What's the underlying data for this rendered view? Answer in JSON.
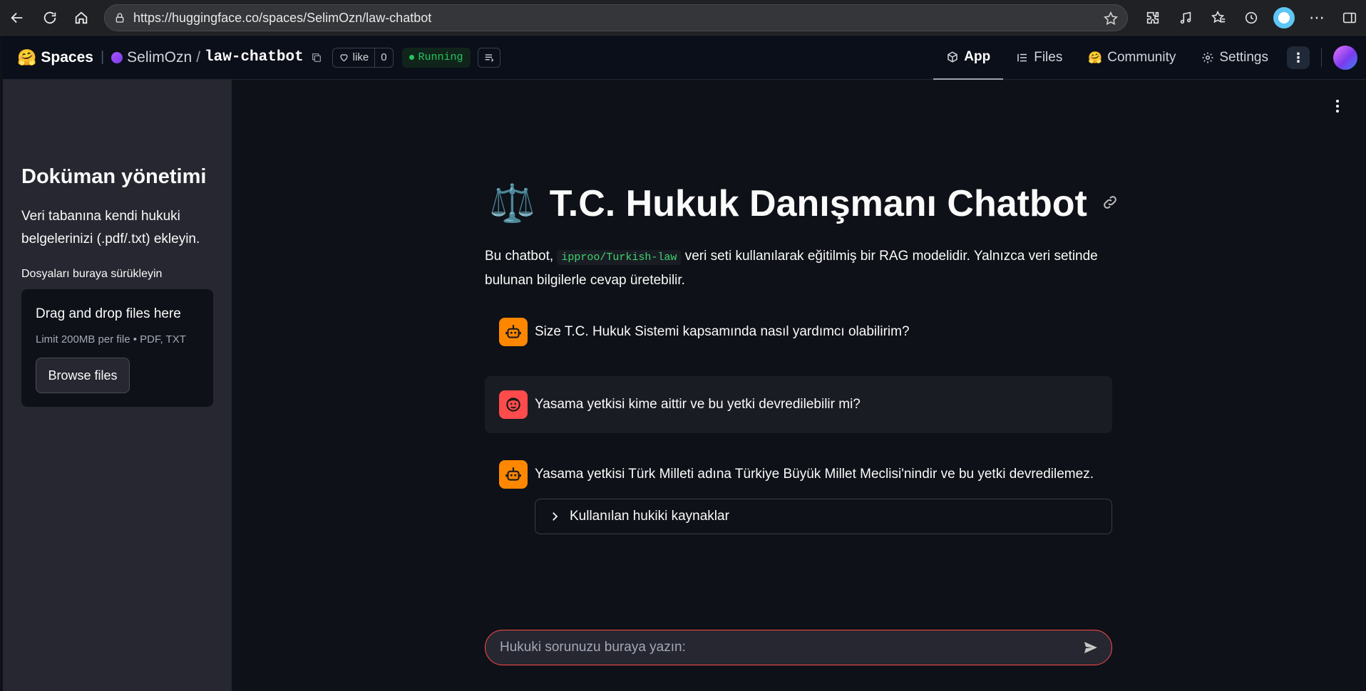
{
  "browser": {
    "url": "https://huggingface.co/spaces/SelimOzn/law-chatbot"
  },
  "header": {
    "logo_label": "Spaces",
    "logo_emoji": "🤗",
    "owner": "SelimOzn",
    "repo": "law-chatbot",
    "like_label": "like",
    "like_count": "0",
    "status": "Running",
    "tabs": [
      {
        "label": "App",
        "icon": "cube-icon",
        "active": true
      },
      {
        "label": "Files",
        "icon": "files-icon",
        "active": false
      },
      {
        "label": "Community",
        "icon": "community-icon",
        "active": false
      },
      {
        "label": "Settings",
        "icon": "gear-icon",
        "active": false
      }
    ]
  },
  "sidebar": {
    "title": "Doküman yönetimi",
    "description": "Veri tabanına kendi hukuki belgelerinizi (.pdf/.txt) ekleyin.",
    "upload_label": "Dosyaları buraya sürükleyin",
    "dropzone_title": "Drag and drop files here",
    "dropzone_limit": "Limit 200MB per file • PDF, TXT",
    "browse_label": "Browse files"
  },
  "main": {
    "title_emoji": "⚖️",
    "title": "T.C. Hukuk Danışmanı Chatbot",
    "intro_before": "Bu chatbot, ",
    "intro_code": "ipproo/Turkish-law",
    "intro_after": " veri seti kullanılarak eğitilmiş bir RAG modelidir. Yalnızca veri setinde bulunan bilgilerle cevap üretebilir.",
    "messages": [
      {
        "role": "assistant",
        "text": "Size T.C. Hukuk Sistemi kapsamında nasıl yardımcı olabilirim?"
      },
      {
        "role": "user",
        "text": "Yasama yetkisi kime aittir ve bu yetki devredilebilir mi?"
      },
      {
        "role": "assistant",
        "text": "Yasama yetkisi Türk Milleti adına Türkiye Büyük Millet Meclisi'nindir ve bu yetki devredilemez."
      }
    ],
    "sources_label": "Kullanılan hukiki kaynaklar",
    "chat_placeholder": "Hukuki sorunuzu buraya yazın:"
  },
  "colors": {
    "bot_avatar": "#ff8700",
    "user_avatar": "#ff4b4b",
    "status_green": "#22c55e",
    "accent_red": "#ff4b4b"
  }
}
